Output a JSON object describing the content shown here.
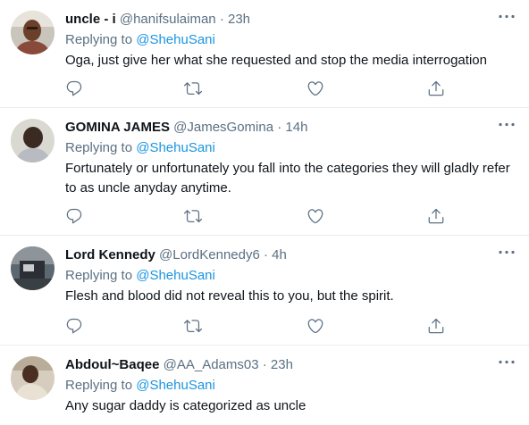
{
  "icons": {
    "more": "more-horizontal-icon",
    "reply": "reply-icon",
    "retweet": "retweet-icon",
    "like": "heart-icon",
    "share": "share-icon"
  },
  "tweets": [
    {
      "name": "uncle - i",
      "handle": "@hanifsulaiman",
      "dot": "·",
      "time": "23h",
      "replying_prefix": "Replying to ",
      "replying_to": "@ShehuSani",
      "text": "Oga, just give her what she requested and stop the media interrogation"
    },
    {
      "name": "GOMINA JAMES",
      "handle": "@JamesGomina",
      "dot": "·",
      "time": "14h",
      "replying_prefix": "Replying to ",
      "replying_to": "@ShehuSani",
      "text": "Fortunately or unfortunately you fall into the categories they will gladly refer to as uncle anyday anytime."
    },
    {
      "name": "Lord Kennedy",
      "handle": "@LordKennedy6",
      "dot": "·",
      "time": "4h",
      "replying_prefix": "Replying to ",
      "replying_to": "@ShehuSani",
      "text": "Flesh and blood did not reveal this to you, but the spirit."
    },
    {
      "name": "Abdoul~Baqee",
      "handle": "@AA_Adams03",
      "dot": "·",
      "time": "23h",
      "replying_prefix": "Replying to ",
      "replying_to": "@ShehuSani",
      "text": "Any sugar daddy is categorized as uncle"
    }
  ],
  "colors": {
    "text": "#0f1419",
    "secondary": "#5b7083",
    "mention": "#1b95e0",
    "divider": "#e6ecf0"
  }
}
